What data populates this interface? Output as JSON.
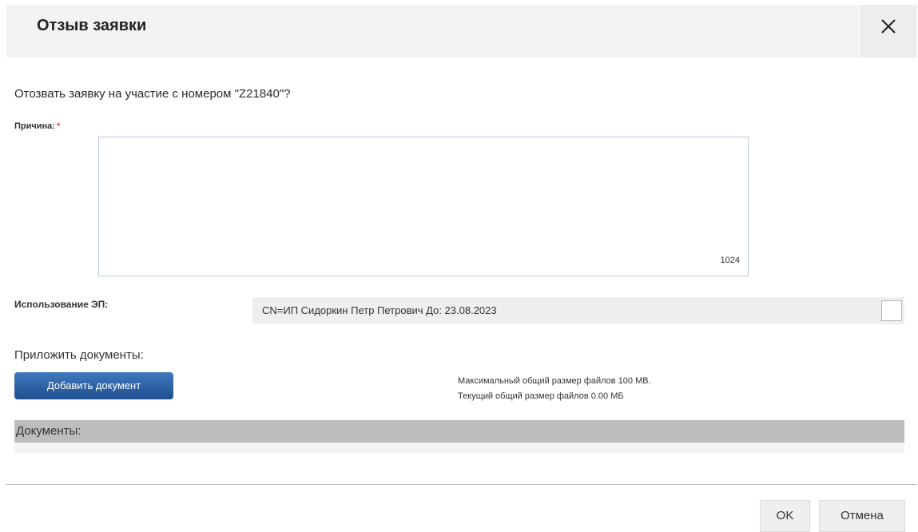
{
  "dialog": {
    "title": "Отзыв заявки",
    "question": "Отозвать заявку на участие с номером \"Z21840\"?"
  },
  "reason": {
    "label": "Причина:",
    "required_mark": "*",
    "value": "",
    "counter": "1024"
  },
  "signature": {
    "label": "Использование ЭП:",
    "value": "CN=ИП Сидоркин Петр Петрович До: 23.08.2023"
  },
  "attachments": {
    "label": "Приложить документы:",
    "add_button": "Добавить документ",
    "max_size": "Максимальный общий размер файлов 100 MB.",
    "current_size": "Текущий общий размер файлов  0.00  МБ",
    "documents_header": "Документы:"
  },
  "footer": {
    "ok_label": "OK",
    "cancel_label": "Отмена"
  },
  "colors": {
    "accent": "#2a5ea6",
    "required": "#e0453a"
  },
  "icons": {
    "close": "close-icon"
  }
}
